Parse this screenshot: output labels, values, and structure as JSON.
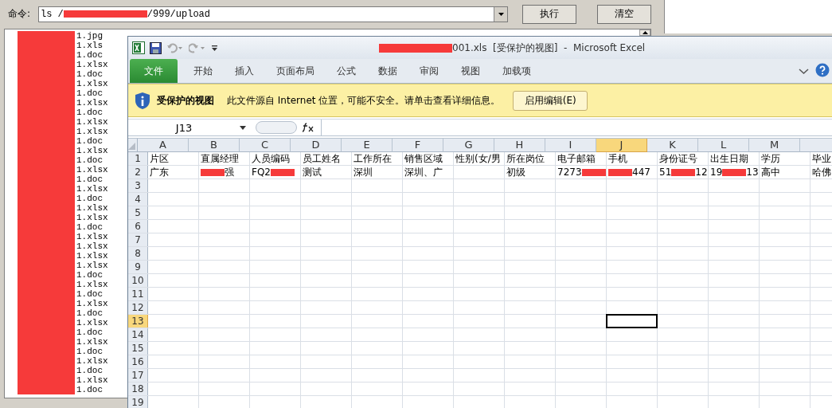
{
  "command": {
    "label": "命令:",
    "value": [
      "ls /",
      "/999/upload"
    ]
  },
  "buttons": [
    "执行",
    "清空"
  ],
  "files": [
    "1.jpg",
    "1.xls",
    "1.doc",
    "1.xlsx",
    "1.doc",
    "1.xlsx",
    "1.doc",
    "1.xlsx",
    "1.doc",
    "1.xlsx",
    "1.xlsx",
    "1.doc",
    "1.xlsx",
    "1.doc",
    "1.xlsx",
    "1.doc",
    "1.xlsx",
    "1.doc",
    "1.xlsx",
    "1.xlsx",
    "1.doc",
    "1.xlsx",
    "1.xlsx",
    "1.xlsx",
    "1.xlsx",
    "1.doc",
    "1.xlsx",
    "1.doc",
    "1.xlsx",
    "1.doc",
    "1.xlsx",
    "1.doc",
    "1.xlsx",
    "1.doc",
    "1.xlsx",
    "1.doc",
    "1.xlsx",
    "1.doc"
  ],
  "excel": {
    "title": "001.xls  [受保护的视图]  -  Microsoft Excel",
    "tabs": [
      {
        "label": "文件",
        "selected": true
      },
      {
        "label": "开始",
        "selected": false
      },
      {
        "label": "插入",
        "selected": false
      },
      {
        "label": "页面布局",
        "selected": false
      },
      {
        "label": "公式",
        "selected": false
      },
      {
        "label": "数据",
        "selected": false
      },
      {
        "label": "审阅",
        "selected": false
      },
      {
        "label": "视图",
        "selected": false
      },
      {
        "label": "加载项",
        "selected": false
      }
    ],
    "protected_bar": {
      "title": "受保护的视图",
      "message": "此文件源自 Internet 位置，可能不安全。请单击查看详细信息。",
      "button": "启用编辑(E)"
    },
    "name_box": "J13",
    "columns": [
      {
        "letter": "A",
        "selected": false
      },
      {
        "letter": "B",
        "selected": false
      },
      {
        "letter": "C",
        "selected": false
      },
      {
        "letter": "D",
        "selected": false
      },
      {
        "letter": "E",
        "selected": false
      },
      {
        "letter": "F",
        "selected": false
      },
      {
        "letter": "G",
        "selected": false
      },
      {
        "letter": "H",
        "selected": false
      },
      {
        "letter": "I",
        "selected": false
      },
      {
        "letter": "J",
        "selected": true
      },
      {
        "letter": "K",
        "selected": false
      },
      {
        "letter": "L",
        "selected": false
      },
      {
        "letter": "M",
        "selected": false
      },
      {
        "selected": false
      }
    ],
    "rows": [
      {
        "number": "1",
        "selected": false,
        "cells": [
          {
            "text": [
              "片区"
            ]
          },
          {
            "text": [
              "直属经理"
            ]
          },
          {
            "text": [
              "人员编码"
            ]
          },
          {
            "text": [
              "员工姓名"
            ]
          },
          {
            "text": [
              "工作所在"
            ]
          },
          {
            "text": [
              "销售区域"
            ]
          },
          {
            "text": [
              "性别(女/男"
            ]
          },
          {
            "text": [
              "所在岗位"
            ]
          },
          {
            "text": [
              "电子邮箱"
            ]
          },
          {
            "text": [
              "手机"
            ]
          },
          {
            "text": [
              "身份证号"
            ]
          },
          {
            "text": [
              "出生日期"
            ]
          },
          {
            "text": [
              "学历"
            ]
          },
          {
            "text": [
              "毕业"
            ]
          }
        ]
      },
      {
        "number": "2",
        "selected": false,
        "cells": [
          {
            "text": [
              "广东"
            ]
          },
          {
            "text": [
              "强"
            ],
            "redacted_start": true
          },
          {
            "text": [
              "FQ2"
            ],
            "redacted_end": true
          },
          {
            "text": [
              "测试"
            ]
          },
          {
            "text": [
              "深圳"
            ]
          },
          {
            "text": [
              "深圳、广"
            ]
          },
          {
            "text": []
          },
          {
            "text": [
              "初级"
            ]
          },
          {
            "text": [
              "7273"
            ],
            "redacted_end": true
          },
          {
            "text": [
              "447"
            ],
            "redacted_start": true
          },
          {
            "text": [
              "51",
              "12"
            ]
          },
          {
            "text": [
              "19",
              "13"
            ]
          },
          {
            "text": [
              "高中"
            ]
          },
          {
            "text": [
              "哈佛"
            ]
          }
        ]
      },
      {
        "number": "3",
        "selected": false,
        "cells": []
      },
      {
        "number": "4",
        "selected": false,
        "cells": []
      },
      {
        "number": "5",
        "selected": false,
        "cells": []
      },
      {
        "number": "6",
        "selected": false,
        "cells": []
      },
      {
        "number": "7",
        "selected": false,
        "cells": []
      },
      {
        "number": "8",
        "selected": false,
        "cells": []
      },
      {
        "number": "9",
        "selected": false,
        "cells": []
      },
      {
        "number": "10",
        "selected": false,
        "cells": []
      },
      {
        "number": "11",
        "selected": false,
        "cells": []
      },
      {
        "number": "12",
        "selected": false,
        "cells": []
      },
      {
        "number": "13",
        "selected": true,
        "cells": []
      },
      {
        "number": "14",
        "selected": false,
        "cells": []
      },
      {
        "number": "15",
        "selected": false,
        "cells": []
      },
      {
        "number": "16",
        "selected": false,
        "cells": []
      },
      {
        "number": "17",
        "selected": false,
        "cells": []
      },
      {
        "number": "18",
        "selected": false,
        "cells": []
      },
      {
        "number": "19",
        "selected": false,
        "cells": []
      }
    ]
  }
}
